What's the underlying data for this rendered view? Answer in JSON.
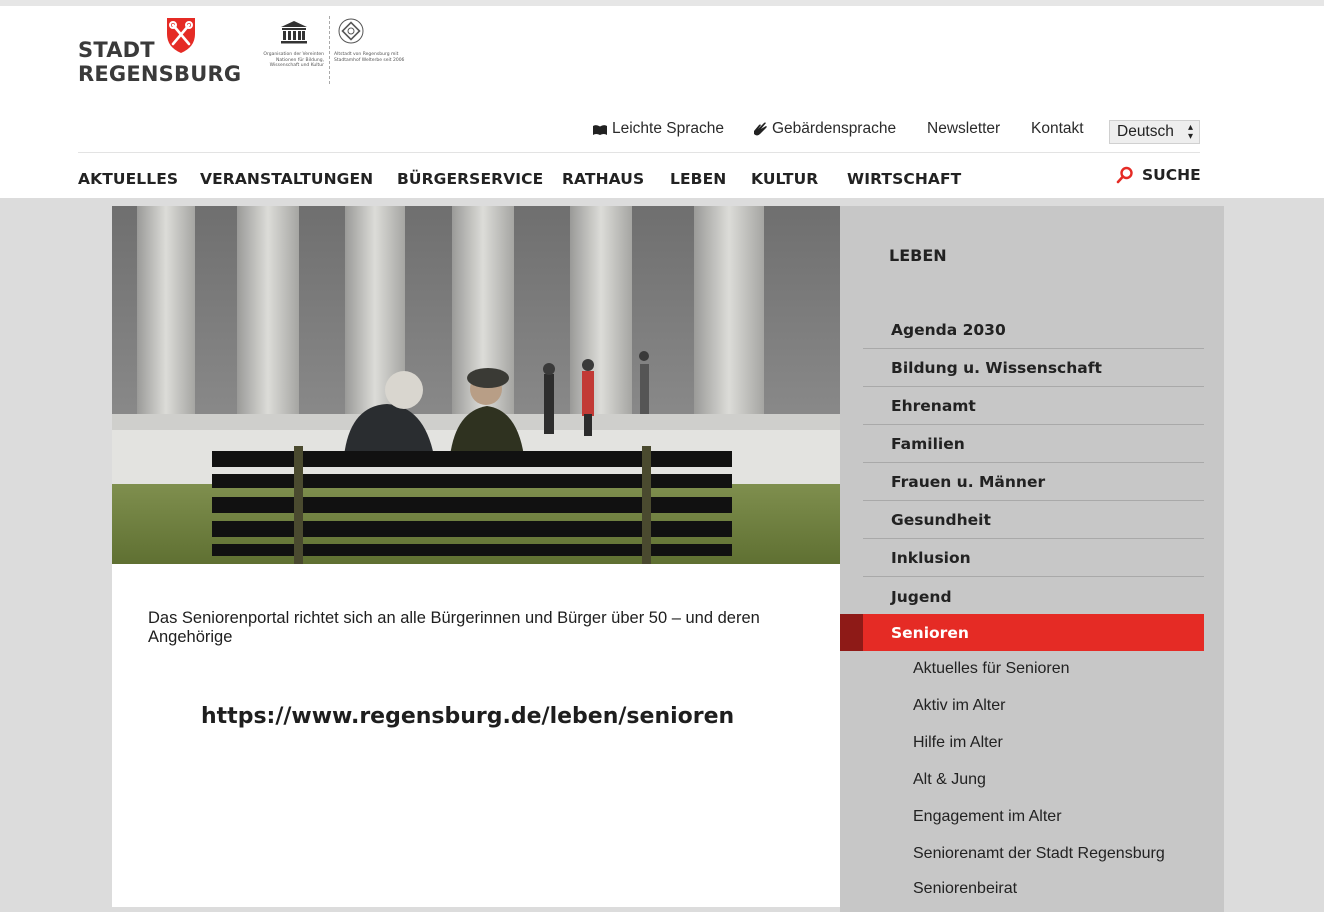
{
  "header": {
    "logo_line1": "STADT",
    "logo_line2": "REGENSBURG",
    "unesco_left": "Organisation der Vereinten Nationen für Bildung, Wissenschaft und Kultur",
    "unesco_right": "Altstadt von Regensburg mit Stadtamhof Welterbe seit 2006"
  },
  "utility": {
    "easy_language": "Leichte Sprache",
    "sign_language": "Gebärdensprache",
    "newsletter": "Newsletter",
    "contact": "Kontakt",
    "language": "Deutsch"
  },
  "nav": {
    "items": [
      "AKTUELLES",
      "VERANSTALTUNGEN",
      "BÜRGERSERVICE",
      "RATHAUS",
      "LEBEN",
      "KULTUR",
      "WIRTSCHAFT"
    ],
    "search": "SUCHE"
  },
  "content": {
    "intro": "Das Seniorenportal richtet sich an alle Bürgerinnen und Bürger über 50 – und deren Angehörige",
    "url": "https://www.regensburg.de/leben/senioren"
  },
  "sidebar": {
    "title": "LEBEN",
    "items": [
      "Agenda 2030",
      "Bildung u. Wissenschaft",
      "Ehrenamt",
      "Familien",
      "Frauen u. Männer",
      "Gesundheit",
      "Inklusion",
      "Jugend"
    ],
    "active": "Senioren",
    "subitems": [
      "Aktuelles für Senioren",
      "Aktiv im Alter",
      "Hilfe im Alter",
      "Alt & Jung",
      "Engagement im Alter",
      "Seniorenamt der Stadt Regensburg",
      "Seniorenbeirat"
    ]
  },
  "colors": {
    "accent": "#e52b25",
    "accent_dark": "#8e1a17",
    "sidebar_bg": "#c7c7c7"
  }
}
